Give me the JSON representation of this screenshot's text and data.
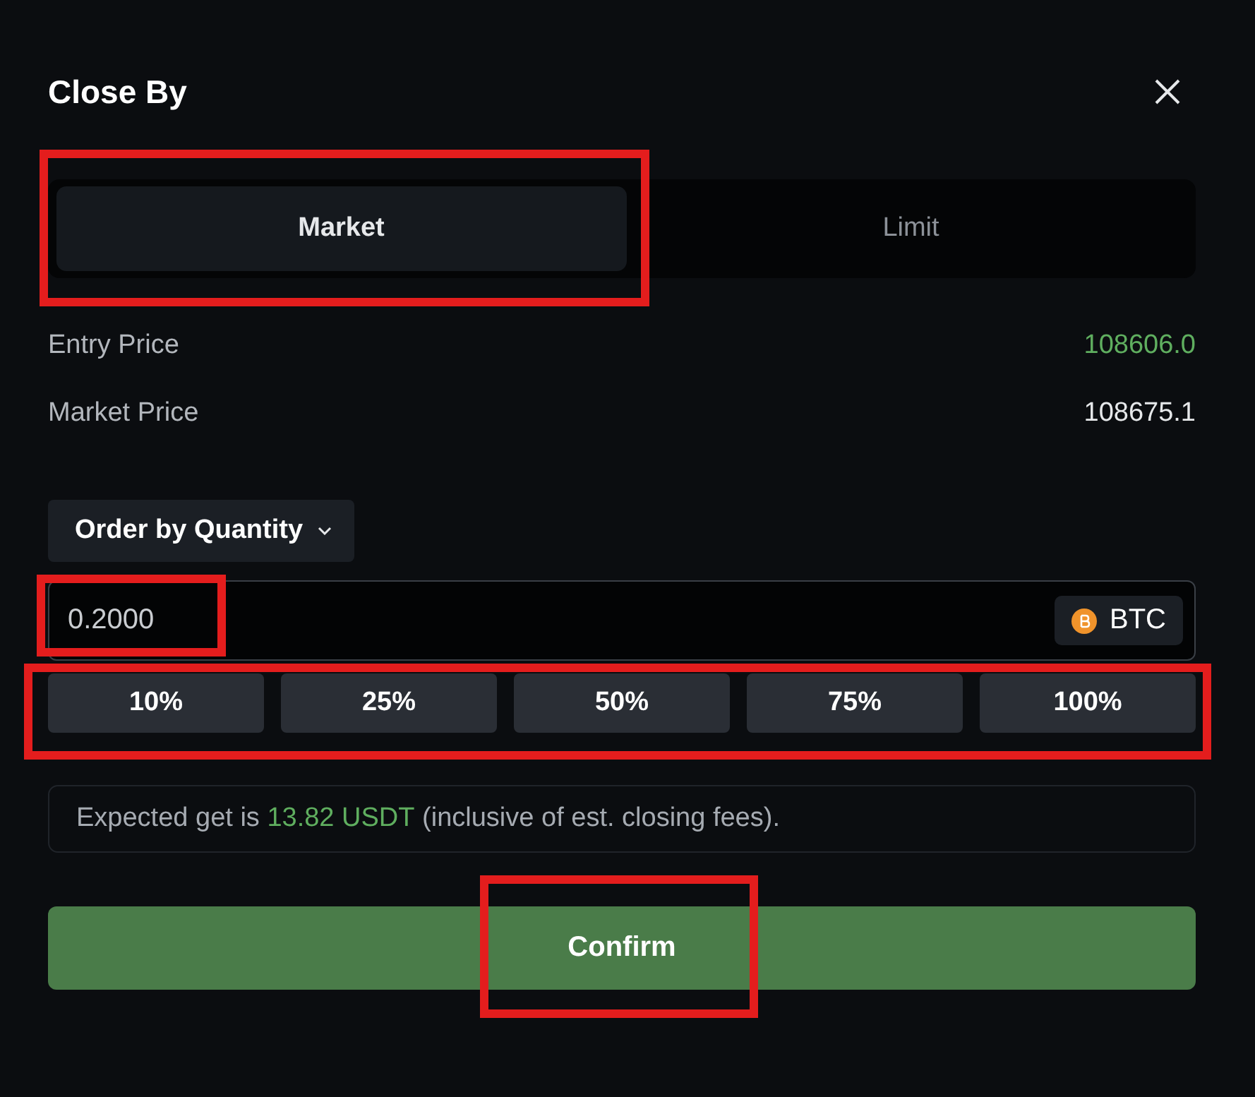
{
  "dialog": {
    "title": "Close By"
  },
  "tabs": [
    {
      "label": "Market",
      "selected": true,
      "highlighted": true
    },
    {
      "label": "Limit",
      "selected": false,
      "highlighted": false
    }
  ],
  "info_rows": [
    {
      "label": "Entry Price",
      "value": "108606.0",
      "positive": true
    },
    {
      "label": "Market Price",
      "value": "108675.1",
      "positive": false
    }
  ],
  "order_type": {
    "label": "Order by Quantity"
  },
  "quantity": {
    "value": "0.2000",
    "unit": "BTC",
    "highlighted": true
  },
  "percent_buttons": {
    "highlighted": true,
    "items": [
      "10%",
      "25%",
      "50%",
      "75%",
      "100%"
    ]
  },
  "expected": {
    "before": "Expected get is ",
    "amount": "13.82 USDT",
    "after": " (inclusive of est. closing fees)."
  },
  "confirm": {
    "label": "Confirm",
    "highlighted": true
  }
}
